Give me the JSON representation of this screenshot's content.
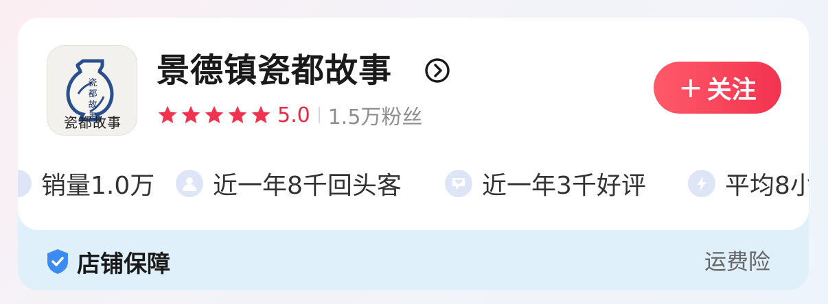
{
  "shop": {
    "name": "景德镇瓷都故事",
    "logo_text": "瓷都故事",
    "rating_stars": 5,
    "rating": "5.0",
    "fans": "1.5万粉丝",
    "follow_label": "关注"
  },
  "stats": [
    {
      "label": "销量1.0万",
      "icon": "sales-icon"
    },
    {
      "label": "近一年8千回头客",
      "icon": "user-icon"
    },
    {
      "label": "近一年3千好评",
      "icon": "comment-heart-icon"
    },
    {
      "label": "平均8小",
      "icon": "lightning-icon"
    }
  ],
  "guarantee": {
    "title": "店铺保障",
    "item": "运费险"
  },
  "colors": {
    "accent": "#f2334f",
    "star": "#f2334f",
    "stat_icon_bg": "#dde5f6",
    "shield": "#3b8bf0"
  }
}
